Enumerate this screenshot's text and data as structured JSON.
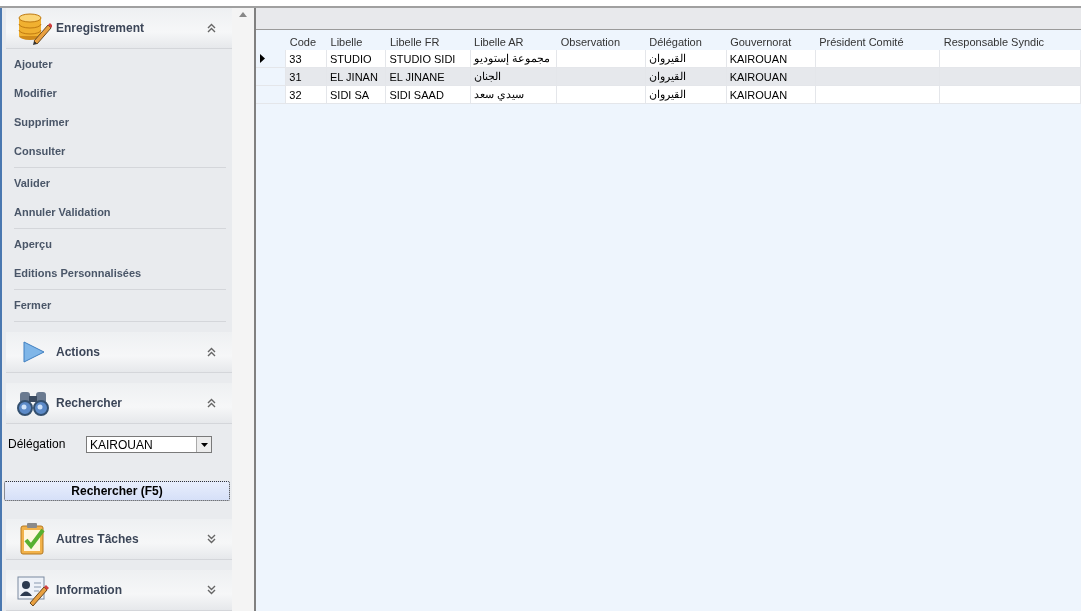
{
  "sidebar": {
    "sections": [
      {
        "kind": "menu",
        "title": "Enregistrement",
        "expanded": true,
        "groups": [
          [
            "Ajouter",
            "Modifier",
            "Supprimer",
            "Consulter"
          ],
          [
            "Valider",
            "Annuler Validation"
          ],
          [
            "Aperçu",
            "Editions Personnalisées"
          ],
          [
            "Fermer"
          ]
        ]
      },
      {
        "title": "Actions",
        "expanded": true
      },
      {
        "kind": "search",
        "title": "Rechercher",
        "expanded": true,
        "field": {
          "label": "Délégation",
          "value": "KAIROUAN"
        },
        "button": "Rechercher (F5)"
      },
      {
        "title": "Autres Tâches",
        "expanded": false
      },
      {
        "title": "Information",
        "expanded": false
      }
    ]
  },
  "table": {
    "columns": [
      "Code",
      "Libelle",
      "Libelle FR",
      "Libelle AR",
      "Observation",
      "Délégation",
      "Gouvernorat",
      "Président Comité",
      "Responsable Syndic"
    ],
    "rows": [
      {
        "current": true,
        "code": "33",
        "libelle": "STUDIO",
        "libelle_fr": "STUDIO SIDI",
        "libelle_ar": "مجموعة إستوديو",
        "delegation": "القيروان",
        "gouvernorat": "KAIROUAN"
      },
      {
        "current": false,
        "code": "31",
        "libelle": "EL JINAN",
        "libelle_fr": "EL JINANE",
        "libelle_ar": "الجنان",
        "delegation": "القيروان",
        "gouvernorat": "KAIROUAN"
      },
      {
        "current": false,
        "code": "32",
        "libelle": "SIDI SA",
        "libelle_fr": "SIDI SAAD",
        "libelle_ar": "سيدي سعد",
        "delegation": "القيروان",
        "gouvernorat": "KAIROUAN"
      }
    ]
  }
}
